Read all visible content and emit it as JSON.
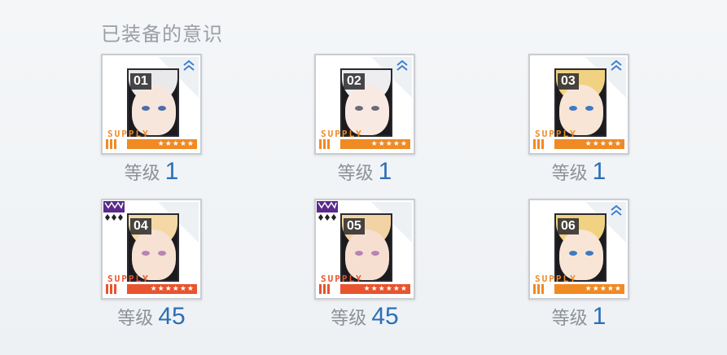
{
  "section_title": "已装备的意识",
  "slots": [
    {
      "num": "01",
      "supply": "SUPPLY",
      "stars": "★★★★★",
      "level_label": "等级",
      "level": "1",
      "theme": "orange",
      "badge": "chevron",
      "hair": "#e9e9ec",
      "skin": "#f7e6dc",
      "eye": "#4a6ea8"
    },
    {
      "num": "02",
      "supply": "SUPPLY",
      "stars": "★★★★★",
      "level_label": "等级",
      "level": "1",
      "theme": "orange",
      "badge": "chevron",
      "hair": "#eeeef0",
      "skin": "#f8eae2",
      "eye": "#6a6a7a"
    },
    {
      "num": "03",
      "supply": "SUPPLY",
      "stars": "★★★★★",
      "level_label": "等级",
      "level": "1",
      "theme": "orange",
      "badge": "chevron",
      "hair": "#f1d283",
      "skin": "#f8e5d6",
      "eye": "#3d7ac4"
    },
    {
      "num": "04",
      "supply": "SUPPLY",
      "stars": "★★★★★★",
      "level_label": "等级",
      "level": "45",
      "theme": "red",
      "badge": "purple-rank",
      "hair": "#f4d9a6",
      "skin": "#f6e1d2",
      "eye": "#b585b5"
    },
    {
      "num": "05",
      "supply": "SUPPLY",
      "stars": "★★★★★★",
      "level_label": "等级",
      "level": "45",
      "theme": "red",
      "badge": "purple-rank",
      "hair": "#f2d3a4",
      "skin": "#f6dfd0",
      "eye": "#b585b5"
    },
    {
      "num": "06",
      "supply": "SUPPLY",
      "stars": "★★★★★",
      "level_label": "等级",
      "level": "1",
      "theme": "orange",
      "badge": "chevron",
      "hair": "#f1d283",
      "skin": "#f8e5d6",
      "eye": "#3d7ac4"
    }
  ],
  "colors": {
    "orange": "#f08a24",
    "red": "#e8542e",
    "chevron": "#3f7fcf",
    "purple": "#5a2a8c",
    "level_value": "#2b6fb8"
  }
}
